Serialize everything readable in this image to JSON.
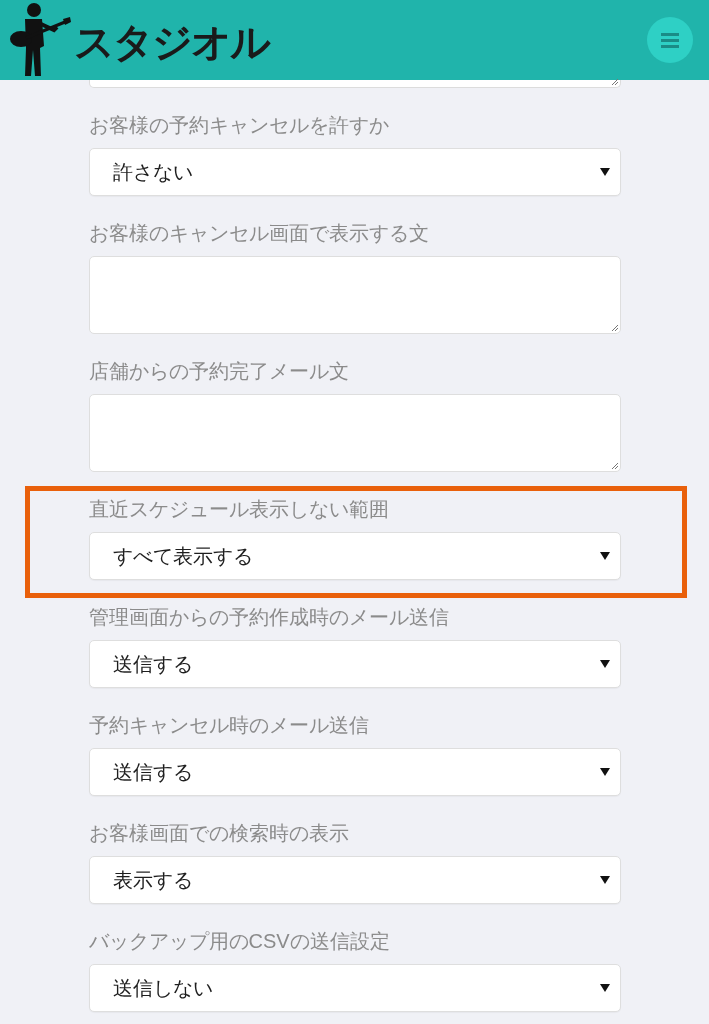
{
  "header": {
    "logo_text": "スタジオル"
  },
  "fields": [
    {
      "kind": "textarea",
      "cut_off": true,
      "highlighted": false
    },
    {
      "kind": "select",
      "cut_off": false,
      "highlighted": false,
      "label": "お客様の予約キャンセルを許すか",
      "value": "許さない"
    },
    {
      "kind": "textarea",
      "cut_off": false,
      "highlighted": false,
      "label": "お客様のキャンセル画面で表示する文"
    },
    {
      "kind": "textarea",
      "cut_off": false,
      "highlighted": false,
      "label": "店舗からの予約完了メール文"
    },
    {
      "kind": "select",
      "cut_off": false,
      "highlighted": true,
      "label": "直近スケジュール表示しない範囲",
      "value": "すべて表示する"
    },
    {
      "kind": "select",
      "cut_off": false,
      "highlighted": false,
      "label": "管理画面からの予約作成時のメール送信",
      "value": "送信する"
    },
    {
      "kind": "select",
      "cut_off": false,
      "highlighted": false,
      "label": "予約キャンセル時のメール送信",
      "value": "送信する"
    },
    {
      "kind": "select",
      "cut_off": false,
      "highlighted": false,
      "label": "お客様画面での検索時の表示",
      "value": "表示する"
    },
    {
      "kind": "select",
      "cut_off": false,
      "highlighted": false,
      "label": "バックアップ用のCSVの送信設定",
      "value": "送信しない"
    }
  ]
}
